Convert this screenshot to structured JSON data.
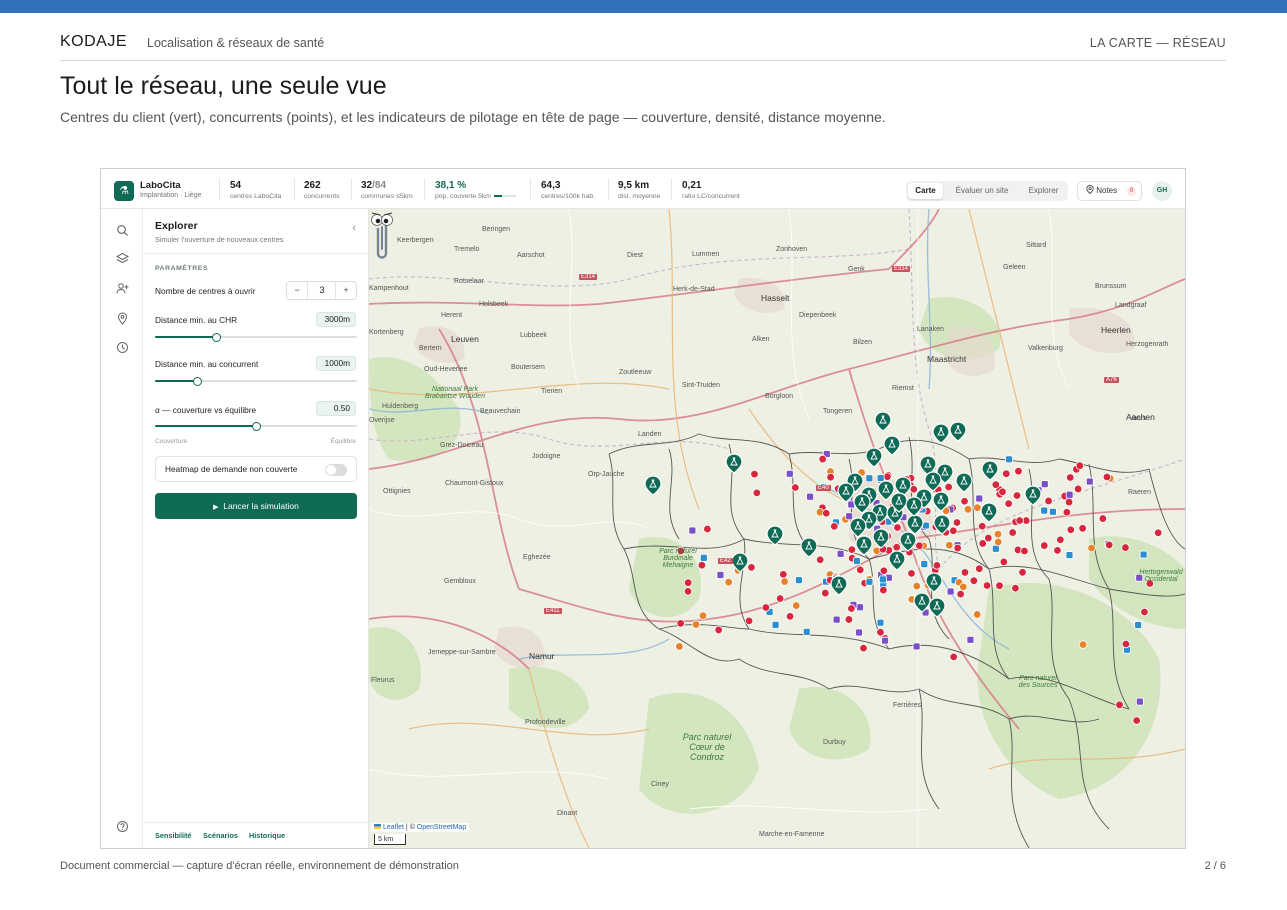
{
  "document": {
    "brand": "KODAJE",
    "subtitle": "Localisation & réseaux de santé",
    "section": "LA CARTE — RÉSEAU",
    "title": "Tout le réseau, une seule vue",
    "description": "Centres du client (vert), concurrents (points), et les indicateurs de pilotage en tête de page — couverture, densité, distance moyenne.",
    "footer_left": "Document commercial — capture d'écran réelle, environnement de démonstration",
    "footer_right": "2 / 6"
  },
  "app": {
    "name": "LaboCita",
    "subtitle": "Implantation · Liège",
    "kpis": [
      {
        "value": "54",
        "label": "centres LaboCita"
      },
      {
        "value": "262",
        "label": "concurrents"
      },
      {
        "value": "32",
        "value_total": "/84",
        "label": "communes ≤5km"
      },
      {
        "value": "38,1 %",
        "label": "pop. couverte 5km",
        "progress": 0.381
      },
      {
        "value": "64,3",
        "label": "centres/100k hab."
      },
      {
        "value": "9,5 km",
        "label": "dist. moyenne"
      },
      {
        "value": "0,21",
        "label": "ratio LC/concurrent"
      }
    ],
    "views": [
      "Carte",
      "Évaluer un site",
      "Explorer"
    ],
    "active_view": "Carte",
    "notes_label": "Notes",
    "notes_count": "0",
    "avatar": "GH",
    "colors": {
      "brand": "#0f6b55",
      "competitor_red": "#d7263d",
      "competitor_orange": "#e8822a",
      "competitor_purple": "#7b4fc9",
      "competitor_blue": "#2b8fcf"
    }
  },
  "rail": {
    "icons": [
      "search-icon",
      "layers-icon",
      "add-user-icon",
      "map-pin-icon",
      "clock-icon",
      "help-icon"
    ]
  },
  "panel": {
    "title": "Explorer",
    "subtitle": "Simuler l'ouverture de nouveaux centres",
    "section": "PARAMÈTRES",
    "centers_label": "Nombre de centres à ouvrir",
    "centers_value": "3",
    "minus": "−",
    "plus": "+",
    "chr_label": "Distance min. au CHR",
    "chr_value": "3000",
    "chr_unit": "m",
    "chr_level": 0.3,
    "conc_label": "Distance min. au concurrent",
    "conc_value": "1000",
    "conc_unit": "m",
    "conc_level": 0.21,
    "alpha_label": "α — couverture vs équilibre",
    "alpha_value": "0.50",
    "alpha_level": 0.5,
    "alpha_left": "Couverture",
    "alpha_right": "Équilibre",
    "heatmap_label": "Heatmap de demande non couverte",
    "heatmap_on": false,
    "run_label": "Lancer la simulation",
    "footer_links": [
      "Sensibilité",
      "Scénarios",
      "Historique"
    ]
  },
  "map": {
    "labels": {
      "cities": [
        "Hasselt",
        "Leuven",
        "Maastricht",
        "Heerlen",
        "Aachen",
        "Namur"
      ],
      "towns": [
        "Beringen",
        "Keerbergen",
        "Tremelo",
        "Aarschot",
        "Diest",
        "Lummen",
        "Zonhoven",
        "Genk",
        "Sittard",
        "Geleen",
        "Brunssum",
        "Rotselaar",
        "Herk-de-Stad",
        "Kampenhout",
        "Holsbeek",
        "Diepenbeek",
        "Kortenberg",
        "Herent",
        "Lubbeek",
        "Bilzen",
        "Lanaken",
        "Landgraaf",
        "Bertem",
        "Alken",
        "Valkenburg",
        "Herzogenrath",
        "Oud-Heverlee",
        "Boutersem",
        "Zoutleeuw",
        "Sint-Truiden",
        "Borgloon",
        "Riemst",
        "Huldenberg",
        "Beauvechain",
        "Tienen",
        "Tongeren",
        "Vaals",
        "Overijse",
        "Landen",
        "Grez-Doiceau",
        "Jodoigne",
        "Orp-Jauche",
        "Chaumont-Gistoux",
        "Ottignies",
        "Raeren",
        "Eghezée",
        "Gembloux",
        "Jemeppe-sur-Sambre",
        "Fleurus",
        "Profondeville",
        "Ferrières",
        "Durbuy",
        "Ciney",
        "Dinant",
        "Marche-en-Famenne"
      ],
      "parks": [
        "Nationaal Park Brabantse Wouden",
        "Parc naturel Burdinale Mehaigne",
        "Parc naturel Cœur de Condroz",
        "Parc naturel des Sources",
        "Hertogenwald Occidental"
      ],
      "roads": [
        "E314",
        "E314",
        "E40",
        "E42",
        "E411",
        "A76"
      ]
    },
    "attribution_leaflet": "Leaflet",
    "attribution_sep": " | © ",
    "attribution_osm": "OpenStreetMap",
    "scale": "5 km"
  }
}
